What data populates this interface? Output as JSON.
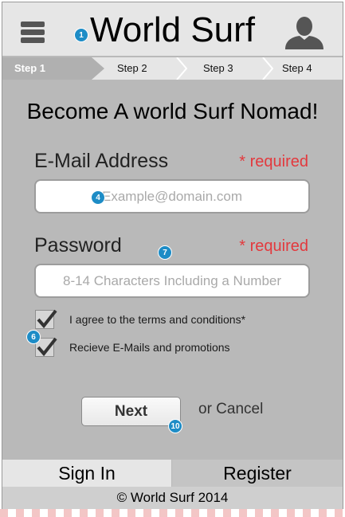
{
  "header": {
    "title": "World Surf",
    "menu_icon": "hamburger-menu-icon",
    "profile_icon": "user-avatar-icon"
  },
  "steps": [
    {
      "label": "Step 1",
      "active": true
    },
    {
      "label": "Step 2",
      "active": false
    },
    {
      "label": "Step 3",
      "active": false
    },
    {
      "label": "Step 4",
      "active": false
    }
  ],
  "form": {
    "headline": "Become A world Surf Nomad!",
    "email": {
      "label": "E-Mail Address",
      "required": "* required",
      "value": "",
      "placeholder": "Example@domain.com"
    },
    "password": {
      "label": "Password",
      "required": "* required",
      "value": "",
      "placeholder": "8-14 Characters Including a Number"
    },
    "checkboxes": [
      {
        "label": "I agree to the terms and conditions*",
        "checked": true
      },
      {
        "label": "Recieve E-Mails and promotions",
        "checked": true
      }
    ],
    "next_label": "Next",
    "cancel_label": "or Cancel"
  },
  "tabs": [
    {
      "label": "Sign In",
      "active": true
    },
    {
      "label": "Register",
      "active": false
    }
  ],
  "footer": {
    "text": "© World Surf 2014"
  },
  "annotations": [
    "1",
    "4",
    "7",
    "6",
    "10"
  ],
  "colors": {
    "required": "#e3393d",
    "annotation": "#1d8cc6",
    "background": "#b9b9b9"
  }
}
